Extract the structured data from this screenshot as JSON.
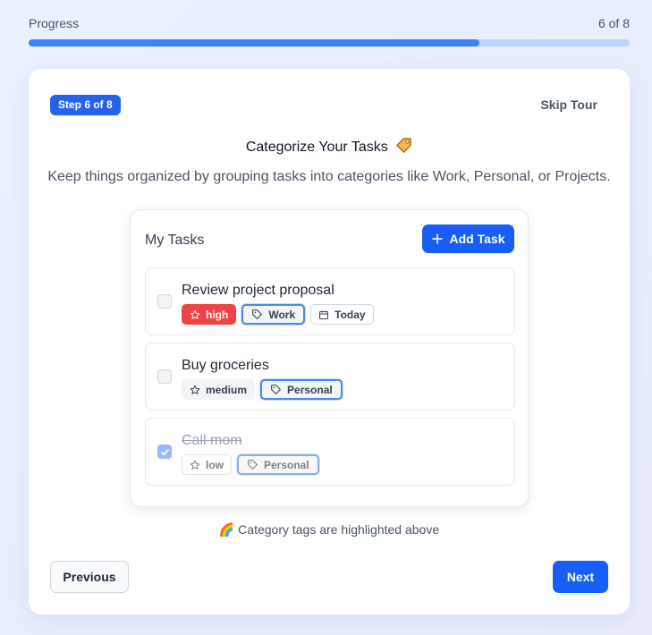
{
  "progress": {
    "label": "Progress",
    "count": "6 of 8",
    "fraction": 0.75,
    "fill_color": "#3b82f6",
    "track_color": "#bcd3fb"
  },
  "tour": {
    "step_badge": "Step 6 of 8",
    "skip_label": "Skip Tour",
    "title": "Categorize Your Tasks",
    "title_icon": "tag-icon",
    "description": "Keep things organized by grouping tasks into categories like Work, Personal, or Projects.",
    "hint": "🌈 Category tags are highlighted above",
    "previous_label": "Previous",
    "next_label": "Next"
  },
  "demo": {
    "title": "My Tasks",
    "add_label": "Add Task",
    "tasks": [
      {
        "name": "Review project proposal",
        "completed": false,
        "priority": "high",
        "category": "Work",
        "due": "Today"
      },
      {
        "name": "Buy groceries",
        "completed": false,
        "priority": "medium",
        "category": "Personal"
      },
      {
        "name": "Call mom",
        "completed": true,
        "priority": "low",
        "category": "Personal"
      }
    ]
  },
  "colors": {
    "primary": "#175ef6",
    "high_priority": "#ef4444",
    "category_highlight": "#4f87e8"
  }
}
